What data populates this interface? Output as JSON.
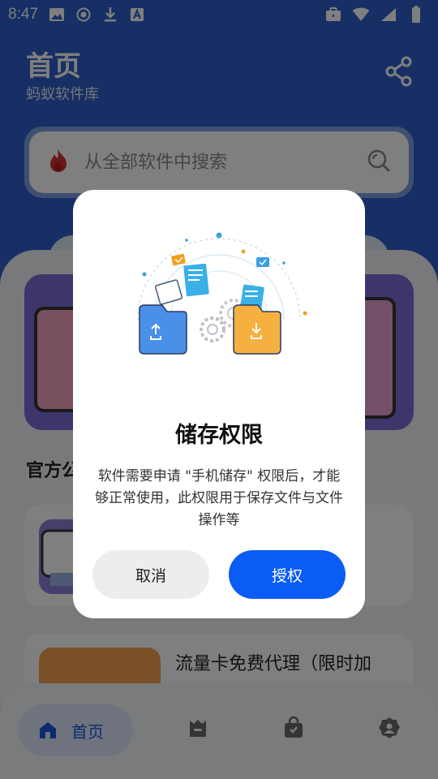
{
  "status_bar": {
    "time": "8:47"
  },
  "header": {
    "title": "首页",
    "subtitle": "蚂蚁软件库"
  },
  "search": {
    "placeholder": "从全部软件中搜索"
  },
  "content": {
    "section_title": "官方公",
    "card_2_title": "流量卡免费代理（限时加"
  },
  "bottom_nav": {
    "home_label": "首页"
  },
  "dialog": {
    "title": "储存权限",
    "message": "软件需要申请 \"手机储存\" 权限后，才能够正常使用，此权限用于保存文件与文件操作等",
    "cancel_label": "取消",
    "confirm_label": "授权"
  },
  "colors": {
    "header_blue": "#2f5fc9",
    "primary_button": "#0a5cf5",
    "home_active": "#1a55e0"
  }
}
